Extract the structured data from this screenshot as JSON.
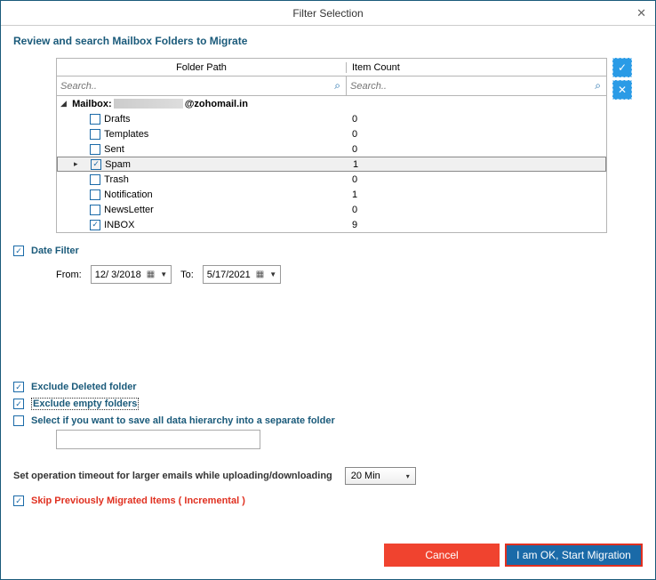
{
  "window": {
    "title": "Filter Selection"
  },
  "instruction": "Review and search Mailbox Folders to Migrate",
  "columns": {
    "path": "Folder Path",
    "count": "Item Count"
  },
  "search": {
    "placeholder": "Search.."
  },
  "mailbox": {
    "prefix": "Mailbox:",
    "domain": "@zohomail.in"
  },
  "folders": [
    {
      "name": "Drafts",
      "count": "0",
      "checked": false,
      "selected": false
    },
    {
      "name": "Templates",
      "count": "0",
      "checked": false,
      "selected": false
    },
    {
      "name": "Sent",
      "count": "0",
      "checked": false,
      "selected": false
    },
    {
      "name": "Spam",
      "count": "1",
      "checked": true,
      "selected": true
    },
    {
      "name": "Trash",
      "count": "0",
      "checked": false,
      "selected": false
    },
    {
      "name": "Notification",
      "count": "1",
      "checked": false,
      "selected": false
    },
    {
      "name": "NewsLetter",
      "count": "0",
      "checked": false,
      "selected": false
    },
    {
      "name": "INBOX",
      "count": "9",
      "checked": true,
      "selected": false
    }
  ],
  "dateFilter": {
    "label": "Date Filter",
    "fromLabel": "From:",
    "toLabel": "To:",
    "from": "12/  3/2018",
    "to": "5/17/2021"
  },
  "options": {
    "excludeDeleted": "Exclude Deleted folder",
    "excludeEmpty": "Exclude empty folders",
    "saveHierarchy": "Select if you want to save all data hierarchy into a separate folder"
  },
  "timeout": {
    "label": "Set operation timeout for larger emails while uploading/downloading",
    "value": "20 Min"
  },
  "skip": {
    "label": "Skip Previously Migrated Items ( Incremental )"
  },
  "buttons": {
    "cancel": "Cancel",
    "start": "I am OK, Start Migration"
  }
}
